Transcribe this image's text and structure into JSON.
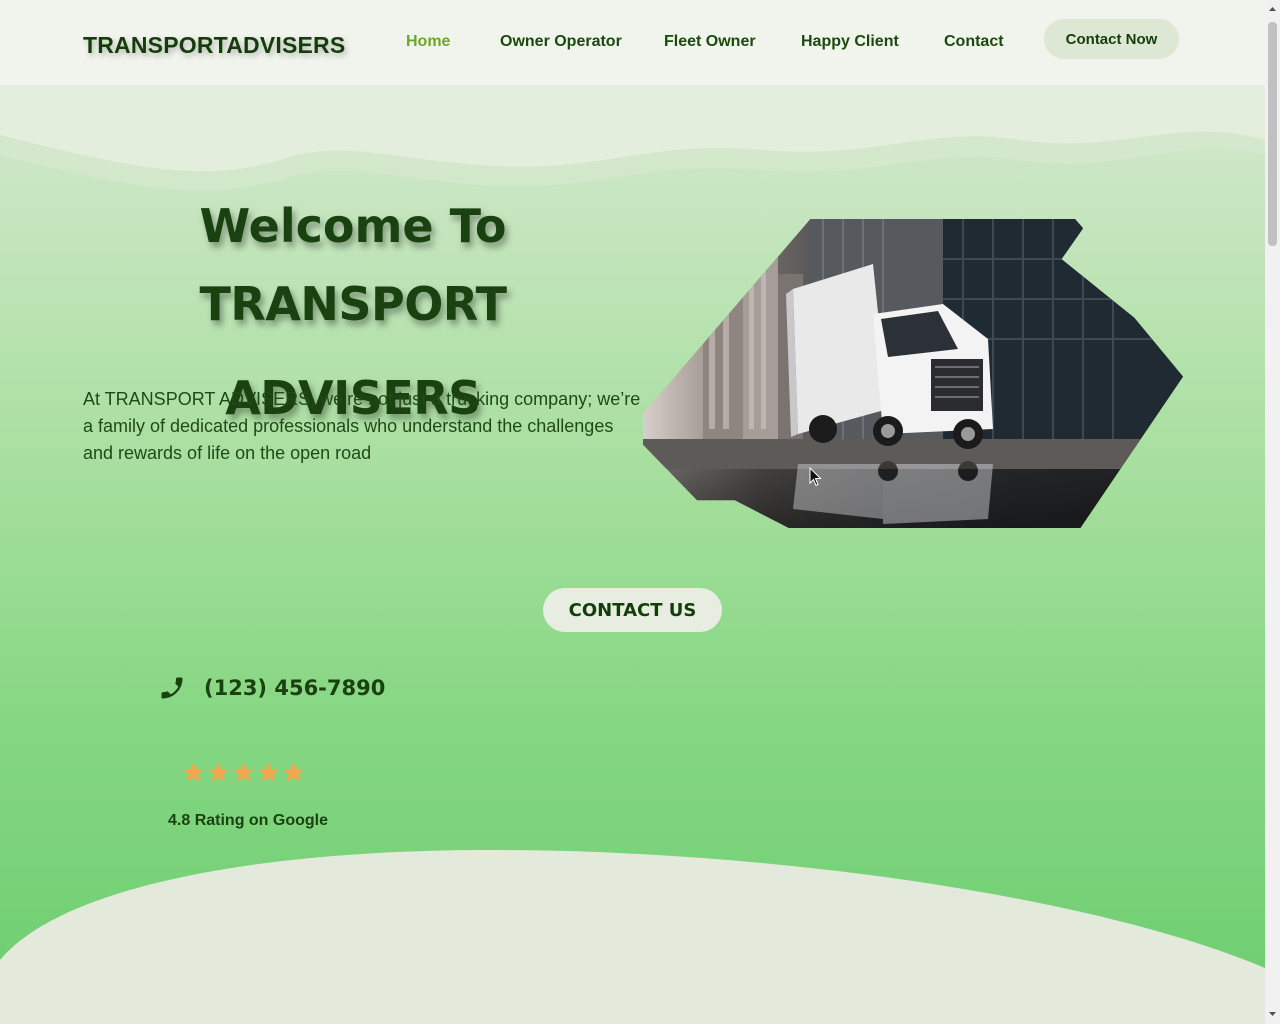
{
  "header": {
    "logo": "TRANSPORTADVISERS",
    "nav": [
      {
        "label": "Home",
        "active": true
      },
      {
        "label": "Owner Operator",
        "active": false
      },
      {
        "label": "Fleet Owner",
        "active": false
      },
      {
        "label": "Happy Client",
        "active": false
      },
      {
        "label": "Contact",
        "active": false
      }
    ],
    "cta_label": "Contact Now"
  },
  "hero": {
    "title_line1": "Welcome To",
    "title_line2": "TRANSPORT ADVISERS",
    "description": "At TRANSPORT ADVISERS, we’re not just a trucking company; we’re a family of dedicated professionals who understand the challenges and rewards of life on the open road",
    "image_subject": "truck-in-city-image"
  },
  "contact": {
    "button_label": "CONTACT US",
    "phone": "(123) 456-7890",
    "phone_icon": "phone-icon"
  },
  "rating": {
    "stars": 5,
    "text": "4.8 Rating on Google"
  },
  "colors": {
    "brand_dark_green": "#153d0c",
    "nav_active": "#6ea62a",
    "star": "#f0a850",
    "light_bg": "#f0f4ec"
  }
}
